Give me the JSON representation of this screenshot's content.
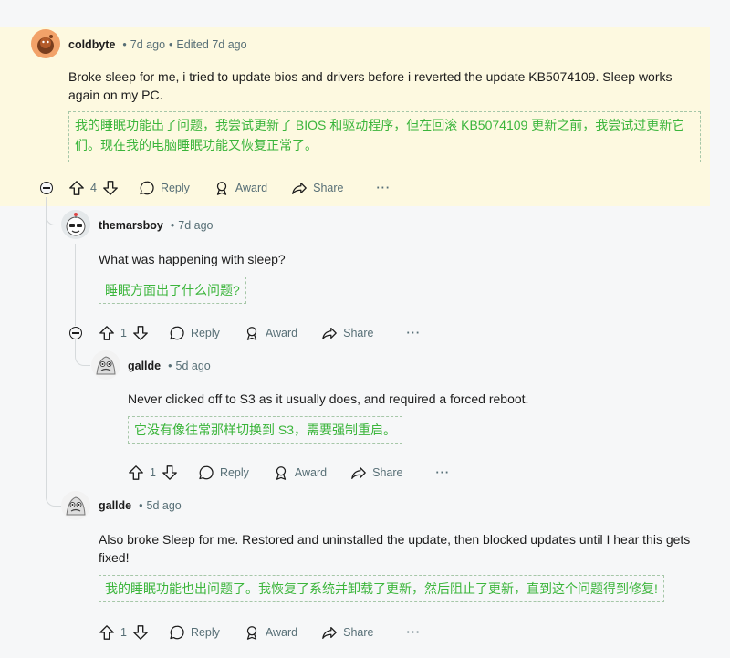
{
  "comments": [
    {
      "user": "coldbyte",
      "time": "7d ago",
      "edited": "Edited 7d ago",
      "text": "Broke sleep for me, i tried to update bios and drivers before i reverted the update KB5074109. Sleep works again on my PC.",
      "translation": "我的睡眠功能出了问题，我尝试更新了 BIOS 和驱动程序，但在回滚 KB5074109 更新之前，我尝试过更新它们。现在我的电脑睡眠功能又恢复正常了。",
      "votes": "4",
      "avatar_color": "#f2a269"
    },
    {
      "user": "themarsboy",
      "time": "7d ago",
      "text": "What was happening with sleep?",
      "translation": "睡眠方面出了什么问题?",
      "votes": "1"
    },
    {
      "user": "gallde",
      "time": "5d ago",
      "text": "Never clicked off to S3 as it usually does, and required a forced reboot.",
      "translation": "它没有像往常那样切换到 S3，需要强制重启。",
      "votes": "1"
    },
    {
      "user": "gallde",
      "time": "5d ago",
      "text": "Also broke Sleep for me. Restored and uninstalled the update, then blocked updates until I hear this gets fixed!",
      "translation": "我的睡眠功能也出问题了。我恢复了系统并卸载了更新，然后阻止了更新，直到这个问题得到修复!",
      "votes": "1"
    }
  ],
  "labels": {
    "reply": "Reply",
    "award": "Award",
    "share": "Share",
    "more": "···"
  },
  "colors": {
    "highlight": "#fdf9e0",
    "translation_text": "#3bb53b",
    "meta": "#576f76"
  }
}
